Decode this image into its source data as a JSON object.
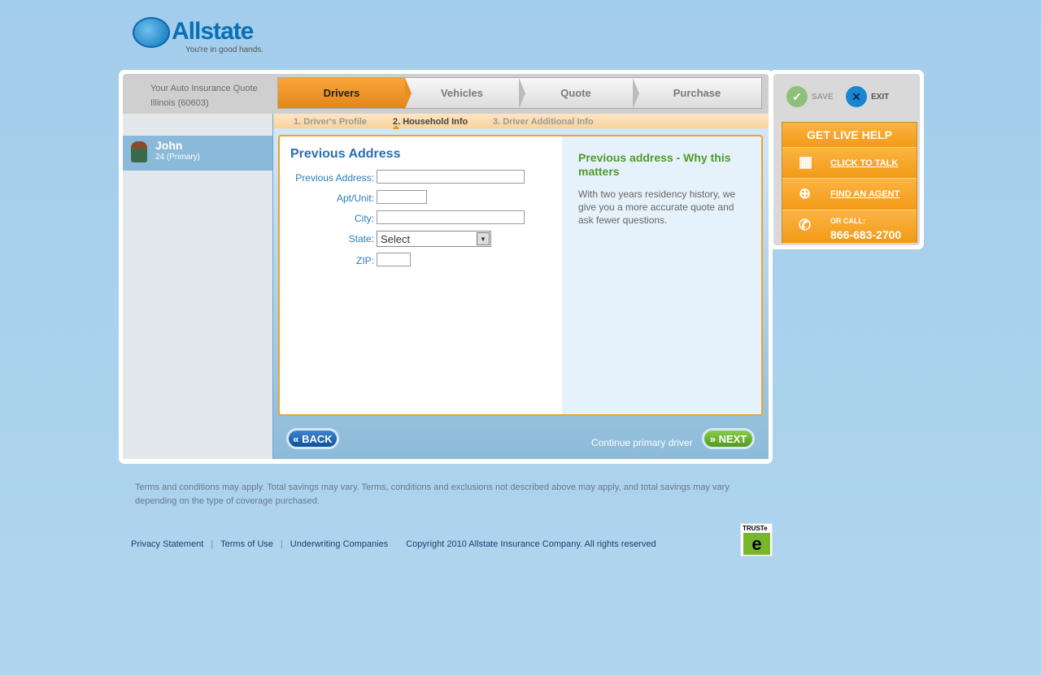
{
  "logo": {
    "word": "Allstate",
    "tagline": "You're in good hands."
  },
  "header": {
    "title": "Your Auto Insurance Quote",
    "location": "Illinois (60603)"
  },
  "tabs": [
    {
      "label": "Drivers",
      "active": true
    },
    {
      "label": "Vehicles"
    },
    {
      "label": "Quote"
    },
    {
      "label": "Purchase"
    }
  ],
  "subtabs": [
    {
      "label": "1. Driver's Profile"
    },
    {
      "label": "2. Household Info",
      "active": true
    },
    {
      "label": "3. Driver Additional Info"
    }
  ],
  "driver": {
    "name": "John",
    "details": "24  (Primary)"
  },
  "form": {
    "title": "Previous Address",
    "fields": [
      {
        "label": "Previous Address:",
        "value": ""
      },
      {
        "label": "Apt/Unit:",
        "value": ""
      },
      {
        "label": "City:",
        "value": ""
      },
      {
        "label": "State:",
        "value": "Select"
      },
      {
        "label": "ZIP:",
        "value": ""
      }
    ]
  },
  "help": {
    "title": "Previous address - Why this matters",
    "body": "With two years residency history, we give you a more accurate quote and ask fewer questions."
  },
  "nav": {
    "back": "« BACK",
    "next": "» NEXT",
    "continue_text": "Continue primary driver"
  },
  "right": {
    "save": "SAVE",
    "exit": "EXIT",
    "live_help": "GET LIVE HELP",
    "click_to_talk": "CLICK TO TALK",
    "find_agent": "FIND AN AGENT",
    "or_call": "OR CALL:",
    "phone": "866-683-2700"
  },
  "footer": {
    "terms": "Terms and conditions may apply. Total savings may vary.  Terms, conditions and exclusions not described above may apply, and total savings may vary depending on the type of coverage purchased.",
    "links": [
      "Privacy Statement",
      "Terms of Use",
      "Underwriting Companies"
    ],
    "separator": "|",
    "copyright": "Copyright 2010 Allstate Insurance Company. All rights reserved",
    "truste": "TRUSTe"
  }
}
